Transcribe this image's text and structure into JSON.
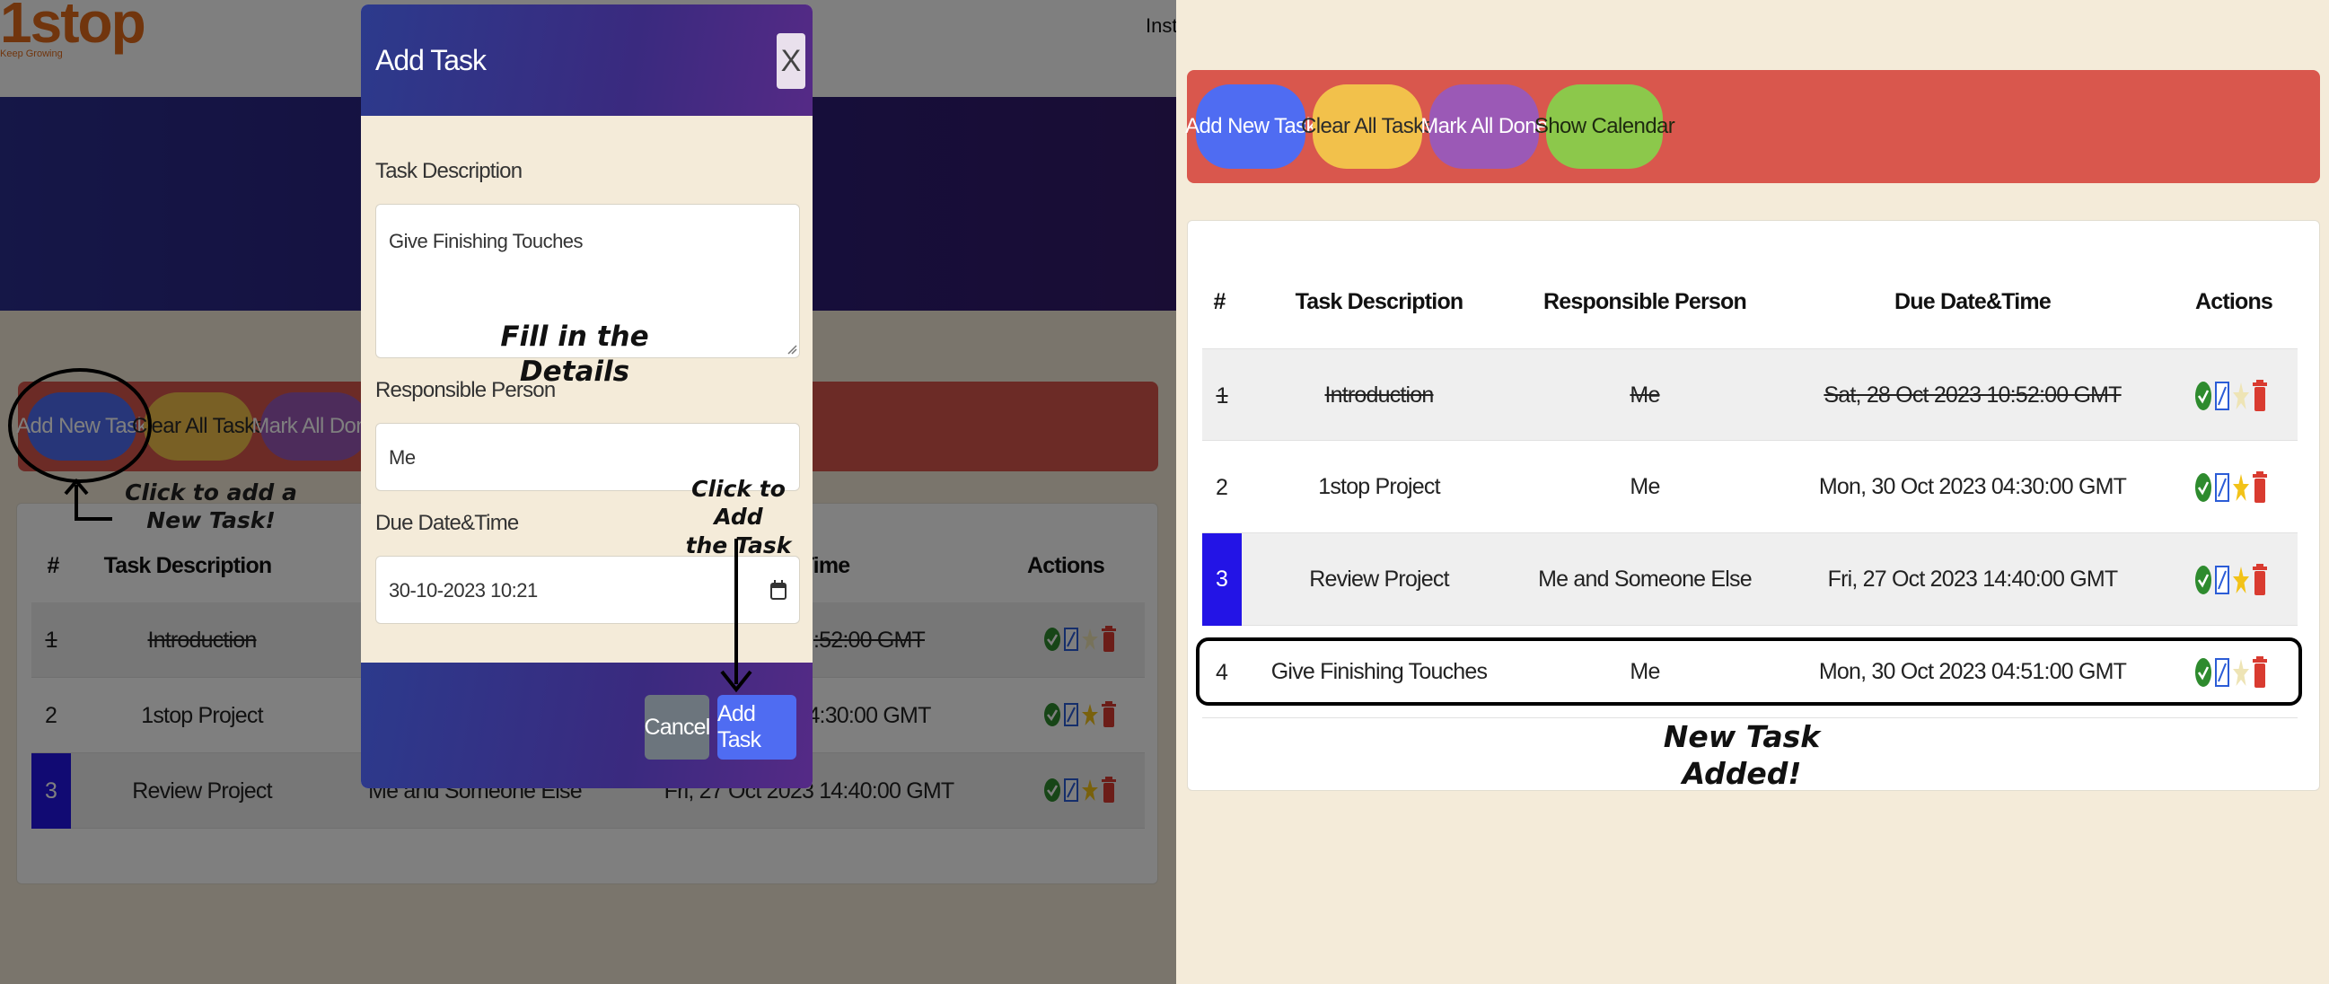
{
  "left_screen": {
    "header": {
      "logo_text": "1stop",
      "logo_tagline": "Keep Growing",
      "nav_partial": "Instr"
    },
    "toolbar": {
      "add_new_task": "Add New Task",
      "clear_all_tasks": "Clear All Tasks",
      "mark_all_done": "Mark All Done"
    },
    "table": {
      "headers": {
        "num": "#",
        "task_description": "Task Description",
        "due": "Time",
        "actions": "Actions"
      },
      "rows": [
        {
          "num": "1",
          "task": "Introduction",
          "due_partial": ":52:00 GMT",
          "done": true
        },
        {
          "num": "2",
          "task": "1stop Project",
          "due_partial": "4:30:00 GMT",
          "done": false
        },
        {
          "num": "3",
          "task": "Review Project",
          "person": "Me and Someone Else",
          "due_partial": "Fri, 27 Oct 2023 14:40:00 GMT",
          "done": false,
          "highlight": true
        }
      ]
    },
    "modal": {
      "title": "Add Task",
      "close_label": "X",
      "task_description_label": "Task Description",
      "task_description_value": "Give Finishing Touches",
      "responsible_person_label": "Responsible Person",
      "responsible_person_value": "Me",
      "due_label": "Due Date&Time",
      "due_value": "30-10-2023 10:21",
      "cancel_label": "Cancel",
      "add_task_label": "Add Task"
    },
    "annotations": {
      "fill_details_1": "Fill in the",
      "fill_details_2": "Details",
      "click_add_new_1": "Click to add a",
      "click_add_new_2": "New Task!",
      "click_add_task_1": "Click to Add",
      "click_add_task_2": "the Task"
    }
  },
  "right_screen": {
    "toolbar": {
      "add_new_task": "Add New Task",
      "clear_all_tasks": "Clear All Tasks",
      "mark_all_done": "Mark All Done",
      "show_calendar": "Show Calendar"
    },
    "table": {
      "headers": {
        "num": "#",
        "task_description": "Task Description",
        "responsible_person": "Responsible Person",
        "due": "Due Date&Time",
        "actions": "Actions"
      },
      "rows": [
        {
          "num": "1",
          "task": "Introduction",
          "person": "Me",
          "due": "Sat, 28 Oct 2023 10:52:00 GMT",
          "done": true,
          "starred": false
        },
        {
          "num": "2",
          "task": "1stop Project",
          "person": "Me",
          "due": "Mon, 30 Oct 2023 04:30:00 GMT",
          "done": false,
          "starred": true
        },
        {
          "num": "3",
          "task": "Review Project",
          "person": "Me and Someone Else",
          "due": "Fri, 27 Oct 2023 14:40:00 GMT",
          "done": false,
          "starred": true,
          "highlight": true
        },
        {
          "num": "4",
          "task": "Give Finishing Touches",
          "person": "Me",
          "due": "Mon, 30 Oct 2023 04:51:00 GMT",
          "done": false,
          "starred": false
        }
      ]
    },
    "annotations": {
      "new_task_1": "New Task",
      "new_task_2": "Added!"
    }
  },
  "colors": {
    "toolbar_bg": "#d9574d",
    "btn_blue": "#4f6cf2",
    "btn_yellow": "#f2c14b",
    "btn_purple": "#9b59b6",
    "btn_green": "#8cc84b",
    "highlight_blue": "#2314e6",
    "page_bg": "#f4ebd9"
  },
  "icons": [
    "check-circle-icon",
    "edit-icon",
    "star-icon",
    "trash-icon",
    "calendar-icon"
  ]
}
